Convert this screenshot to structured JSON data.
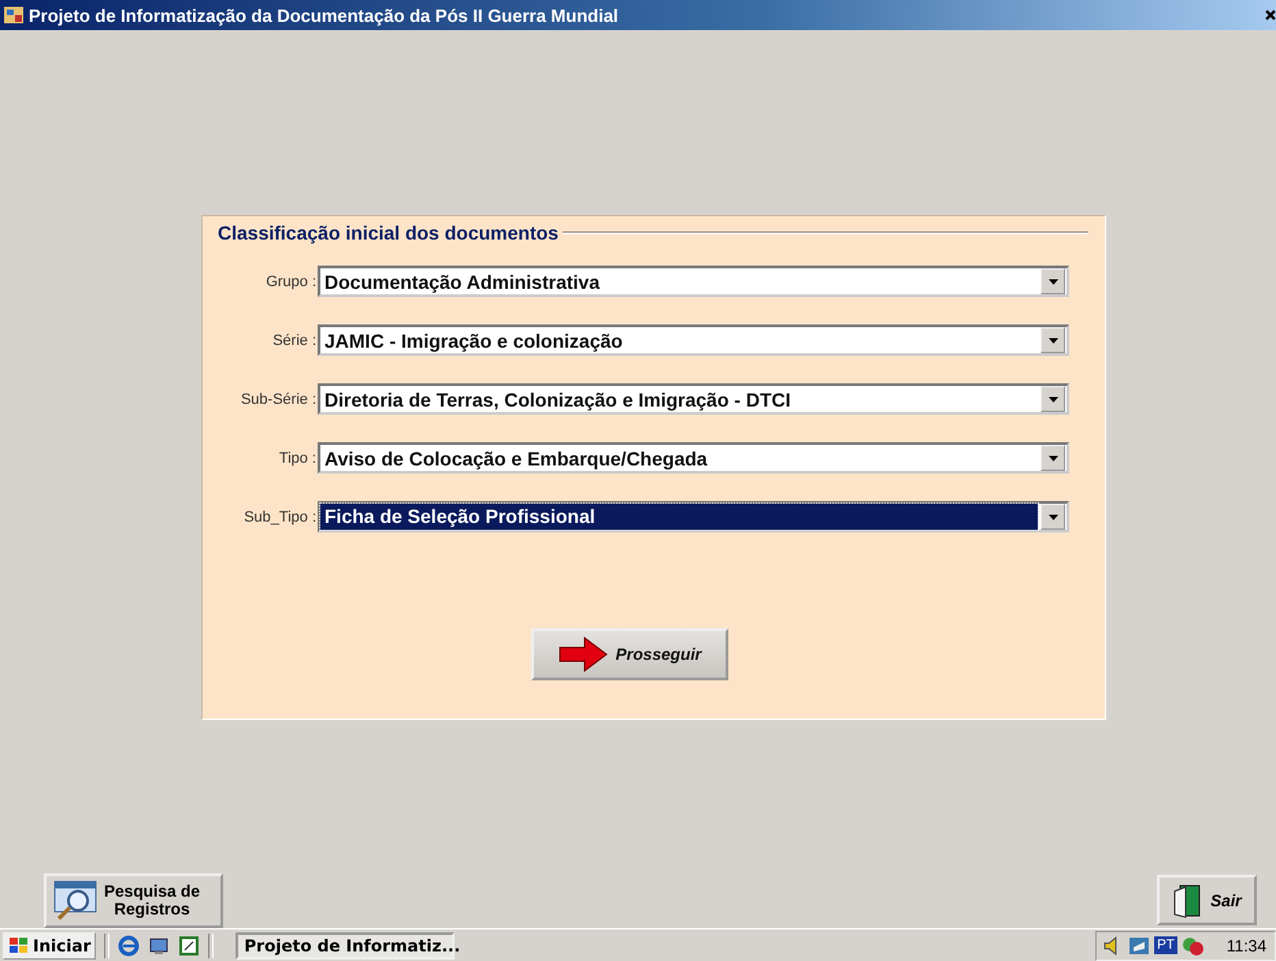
{
  "window": {
    "title": "Projeto de Informatização da Documentação da Pós II Guerra Mundial"
  },
  "group": {
    "title": "Classificação inicial dos documentos",
    "fields": [
      {
        "label": "Grupo :",
        "value": "Documentação Administrativa",
        "selected": false
      },
      {
        "label": "Série :",
        "value": "JAMIC - Imigração e colonização",
        "selected": false
      },
      {
        "label": "Sub-Série :",
        "value": "Diretoria de Terras, Colonização e Imigração - DTCI",
        "selected": false
      },
      {
        "label": "Tipo :",
        "value": "Aviso de Colocação e Embarque/Chegada",
        "selected": false
      },
      {
        "label": "Sub_Tipo :",
        "value": "Ficha de Seleção Profissional",
        "selected": true
      }
    ],
    "button": "Prosseguir"
  },
  "search_button": {
    "line_1": "Pesquisa de",
    "line_2": "Registros"
  },
  "exit_button": "Sair",
  "taskbar": {
    "start": "Iniciar",
    "task": "Projeto de Informatiz...",
    "language": "PT",
    "clock": "11:34"
  }
}
